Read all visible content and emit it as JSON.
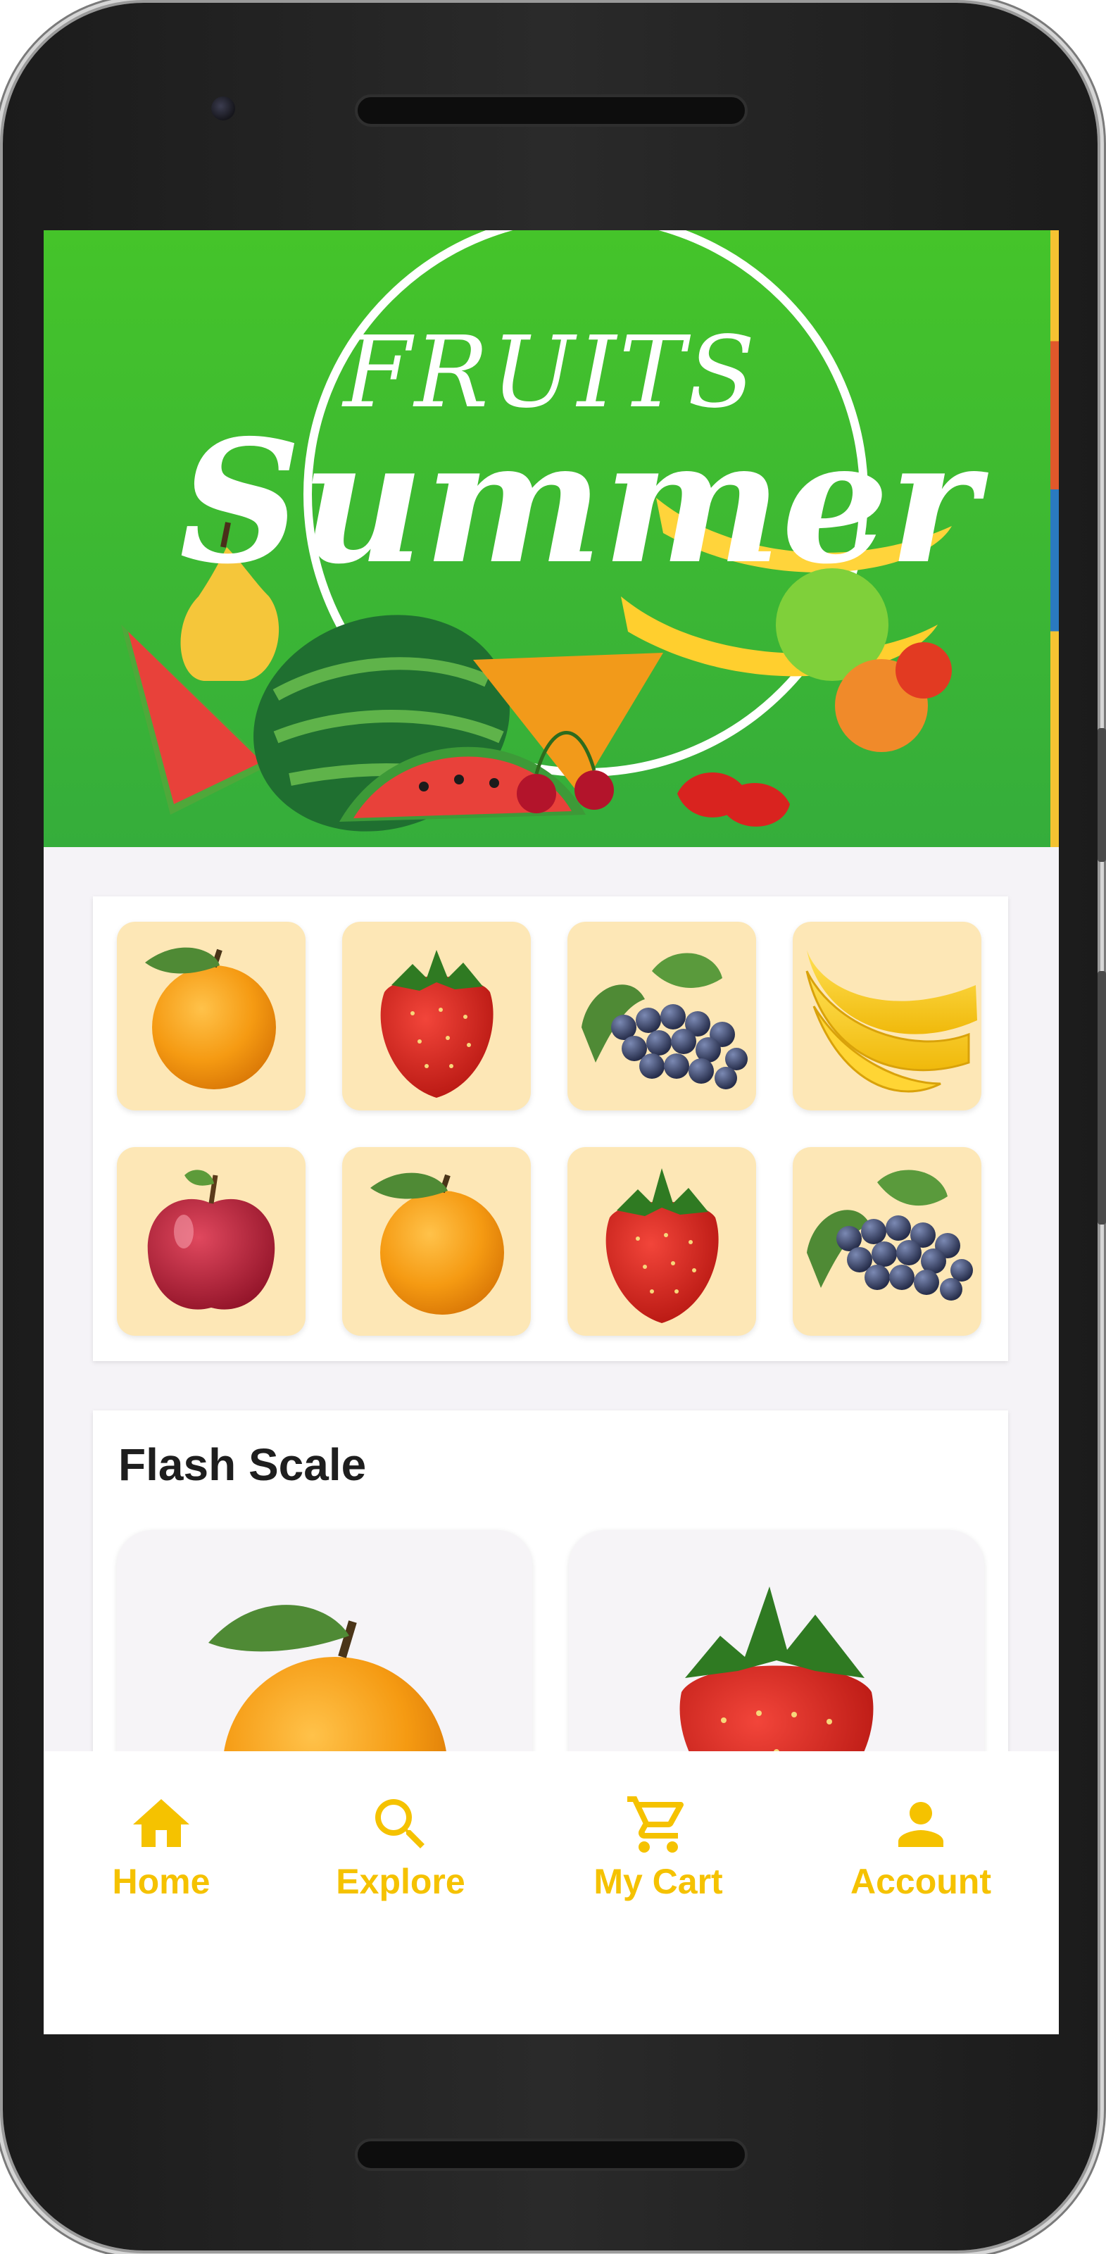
{
  "banner": {
    "line1": "FRUITS",
    "line2": "Summer"
  },
  "categories": [
    {
      "icon": "orange-icon"
    },
    {
      "icon": "strawberry-icon"
    },
    {
      "icon": "grapes-icon"
    },
    {
      "icon": "banana-icon"
    },
    {
      "icon": "apple-icon"
    },
    {
      "icon": "orange-icon"
    },
    {
      "icon": "strawberry-icon"
    },
    {
      "icon": "grapes-icon"
    }
  ],
  "flash_sale": {
    "title": "Flash Scale",
    "products": [
      {
        "icon": "orange-icon"
      },
      {
        "icon": "strawberry-icon"
      }
    ]
  },
  "nav": {
    "items": [
      {
        "label": "Home",
        "icon": "home-icon"
      },
      {
        "label": "Explore",
        "icon": "search-icon"
      },
      {
        "label": "My Cart",
        "icon": "cart-icon"
      },
      {
        "label": "Account",
        "icon": "account-icon"
      }
    ]
  },
  "colors": {
    "accent": "#f5c200",
    "banner_green": "#3fbb2f",
    "tile_bg": "#fde7b6",
    "screen_bg": "#f5f3f7"
  }
}
